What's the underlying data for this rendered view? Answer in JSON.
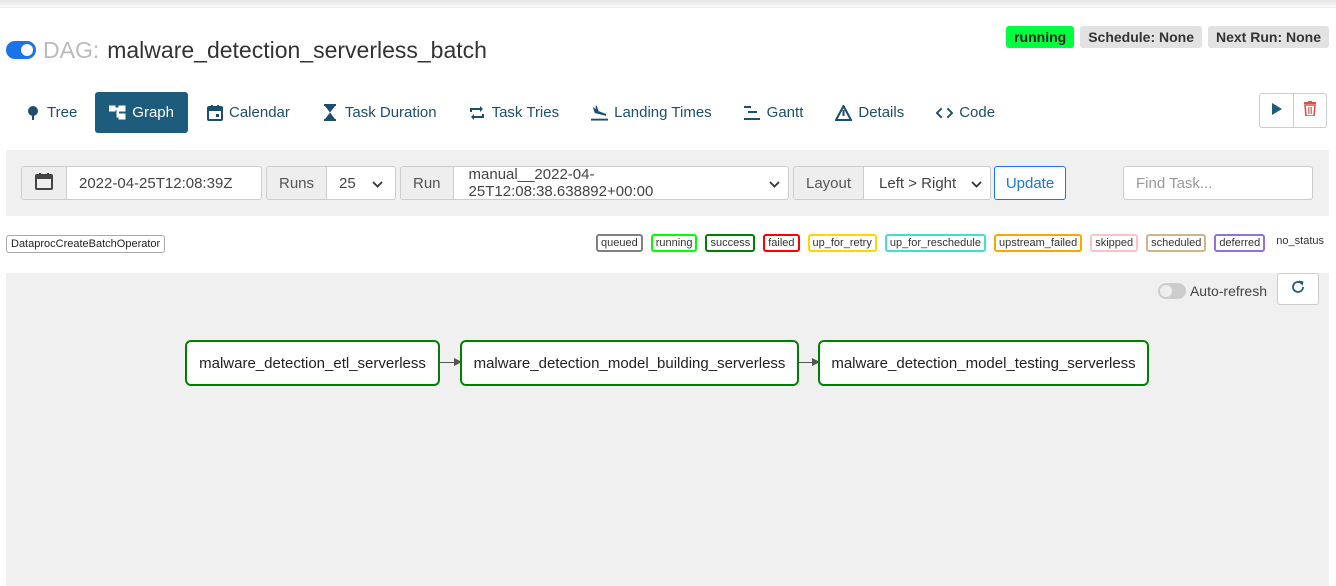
{
  "dag": {
    "toggle_state": "on",
    "label": "DAG:",
    "id": "malware_detection_serverless_batch",
    "badges": [
      {
        "text": "running",
        "color": "#00ff3c"
      },
      {
        "text": "Schedule: None",
        "color": "#e2e2e2"
      },
      {
        "text": "Next Run: None",
        "color": "#e2e2e2"
      }
    ]
  },
  "nav": {
    "tabs": [
      {
        "label": "Tree",
        "icon": "tree-icon"
      },
      {
        "label": "Graph",
        "icon": "graph-icon",
        "active": true
      },
      {
        "label": "Calendar",
        "icon": "calendar-icon"
      },
      {
        "label": "Task Duration",
        "icon": "hourglass-icon"
      },
      {
        "label": "Task Tries",
        "icon": "repeat-icon"
      },
      {
        "label": "Landing Times",
        "icon": "plane-landing-icon"
      },
      {
        "label": "Gantt",
        "icon": "gantt-icon"
      },
      {
        "label": "Details",
        "icon": "warning-triangle-icon"
      },
      {
        "label": "Code",
        "icon": "code-icon"
      }
    ],
    "actions": [
      {
        "icon": "play-icon",
        "color": "#1d5c7d"
      },
      {
        "icon": "trash-icon",
        "color": "#d9534f"
      }
    ]
  },
  "filters": {
    "date_value": "2022-04-25T12:08:39Z",
    "runs_label": "Runs",
    "runs_value": "25",
    "run_label": "Run",
    "run_value": "manual__2022-04-25T12:08:38.638892+00:00",
    "layout_label": "Layout",
    "layout_value": "Left > Right",
    "update_label": "Update",
    "find_task_placeholder": "Find Task..."
  },
  "legend": {
    "operator": "DataprocCreateBatchOperator",
    "states": [
      {
        "label": "queued",
        "color": "#808080"
      },
      {
        "label": "running",
        "color": "#00ff00"
      },
      {
        "label": "success",
        "color": "#008000"
      },
      {
        "label": "failed",
        "color": "#ff0000"
      },
      {
        "label": "up_for_retry",
        "color": "#ffd700"
      },
      {
        "label": "up_for_reschedule",
        "color": "#40e0d0"
      },
      {
        "label": "upstream_failed",
        "color": "#ffa500"
      },
      {
        "label": "skipped",
        "color": "#ffc0cb"
      },
      {
        "label": "scheduled",
        "color": "#d2b48c"
      },
      {
        "label": "deferred",
        "color": "#9370db"
      },
      {
        "label": "no_status",
        "color": ""
      }
    ]
  },
  "graph": {
    "auto_refresh_label": "Auto-refresh",
    "auto_refresh_state": "off",
    "tasks": [
      {
        "label": "malware_detection_etl_serverless",
        "state": "success"
      },
      {
        "label": "malware_detection_model_building_serverless",
        "state": "success"
      },
      {
        "label": "malware_detection_model_testing_serverless",
        "state": "success"
      }
    ]
  }
}
